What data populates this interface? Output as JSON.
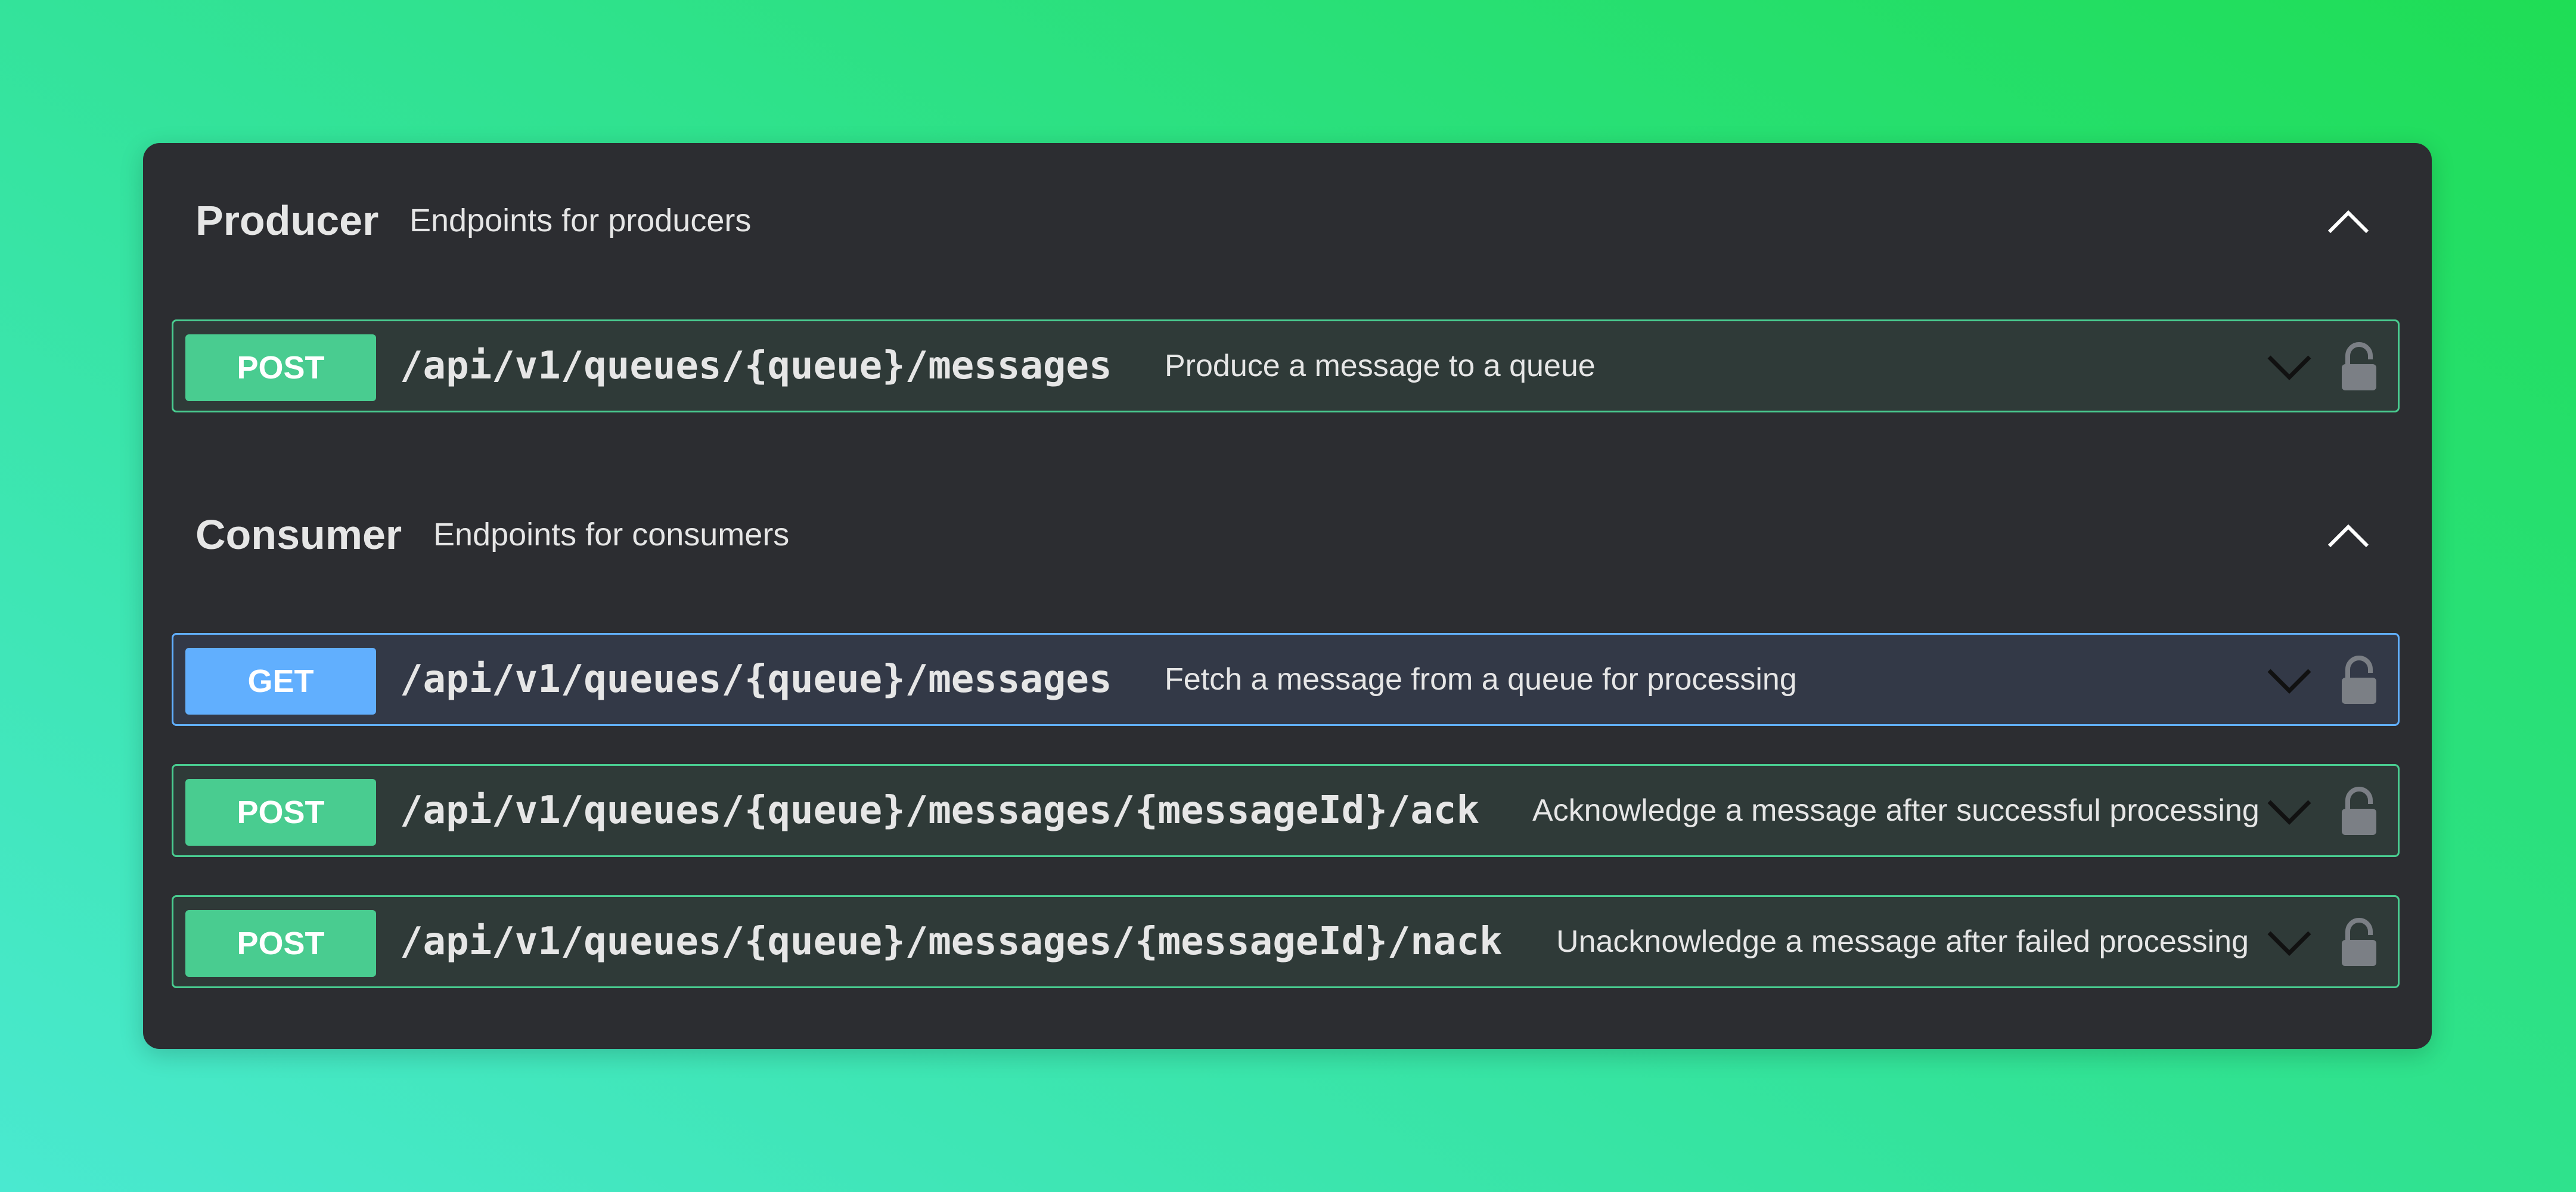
{
  "tags": [
    {
      "name": "Producer",
      "description": "Endpoints for producers",
      "operations": [
        {
          "method": "POST",
          "path": "/api/v1/queues/{queue}/messages",
          "summary": "Produce a message to a queue"
        }
      ]
    },
    {
      "name": "Consumer",
      "description": "Endpoints for consumers",
      "operations": [
        {
          "method": "GET",
          "path": "/api/v1/queues/{queue}/messages",
          "summary": "Fetch a message from a queue for processing"
        },
        {
          "method": "POST",
          "path": "/api/v1/queues/{queue}/messages/{messageId}/ack",
          "summary": "Acknowledge a message after successful processing"
        },
        {
          "method": "POST",
          "path": "/api/v1/queues/{queue}/messages/{messageId}/nack",
          "summary": "Unacknowledge a message after failed processing"
        }
      ]
    }
  ],
  "colors": {
    "post": "#49cc90",
    "get": "#61affe",
    "panel": "#2c2d31",
    "text": "#e6e6e6"
  },
  "icons": {
    "collapse": "chevron-up-icon",
    "expand": "chevron-down-icon",
    "auth": "lock-icon"
  }
}
